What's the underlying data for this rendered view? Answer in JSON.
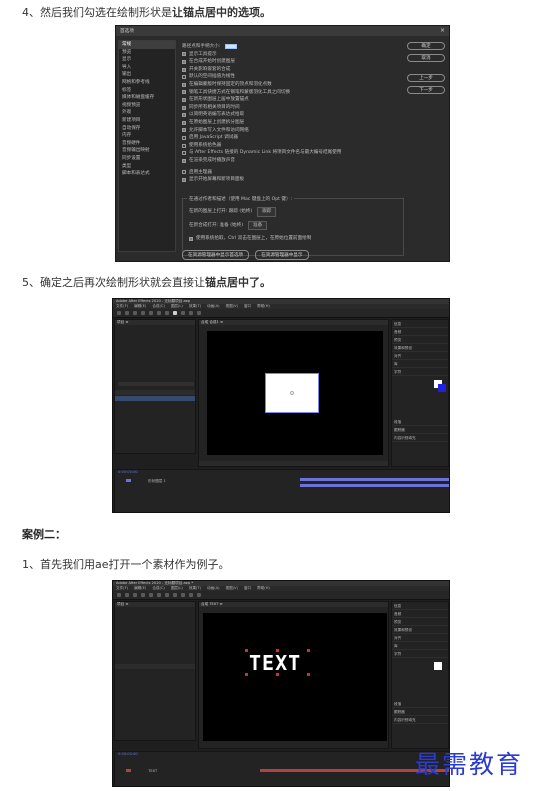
{
  "steps": {
    "s4_prefix": "4、然后我们勾选在绘制形状是",
    "s4_bold": "让锚点居中的选项。",
    "s5_prefix": "5、确定之后再次绘制形状就会直接让",
    "s5_bold": "锚点居中了。",
    "case2": "案例二：",
    "c1": "1、首先我们用ae打开一个素材作为例子。"
  },
  "prefs": {
    "title": "首选项",
    "close": "×",
    "side": [
      "常规",
      "预览",
      "显示",
      "导入",
      "输出",
      "网格和参考线",
      "标签",
      "媒体和磁盘缓存",
      "视频预览",
      "外观",
      "新建项目",
      "自动保存",
      "内存",
      "音频硬件",
      "音频输出映射",
      "同步设置",
      "类型",
      "脚本和表达式"
    ],
    "opts": [
      "路径点和手柄大小:",
      "显示工具提示",
      "在合成开始时创建图层",
      "开关影响嵌套的合成",
      "默认的空间插值为线性",
      "在编辑蒙版时保持固定的顶点和羽化点数",
      "钢笔工具快捷方式在钢笔和蒙版羽化工具之间切换",
      "在新形状图层上居中放置锚点",
      "同步所有相关项目的时间",
      "以简明英语编写表达式拾取",
      "在原始图层上创建拆分图层",
      "允许脚本写入文件和访问网络",
      "启用 JavaScript 调试器",
      "使用系统拾色器",
      "与 After Effects 链接的 Dynamic Link 将项目文件名与最大编号结尾使用",
      "在渲染完成时播放声音"
    ],
    "opts2": [
      "启用主理器",
      "显示开始屏幕和新项目面板"
    ],
    "group_legend": "在通过作者和描述（使用 Mac 键盘上的 Opt 键）:",
    "group_rows": [
      "在新的图层上打开: 跟踪 (始终)",
      "在新合成打开: 准备 (始终)",
      "使用系统拾取，Ctrl 双击在图层上，在原始位置前面绘制"
    ],
    "select_1": "跟踪",
    "select_2": "准备",
    "buttons": [
      "确定",
      "取消",
      "上一步",
      "下一步"
    ],
    "bottom_buttons": [
      "在资源管理器中显示首选项",
      "在资源管理器中显示"
    ],
    "number_value": "1"
  },
  "ae1": {
    "title": "Adobe After Effects 2020 - 无标题项目.aep",
    "menus": [
      "文件(F)",
      "编辑(E)",
      "合成(C)",
      "图层(L)",
      "效果(T)",
      "动画(A)",
      "视图(V)",
      "窗口",
      "帮助(H)"
    ],
    "proj_tab": "项目 ≡",
    "comp_tab": "合成 合成1 ≡",
    "right_items": [
      "信息",
      "音频",
      "预览",
      "效果和预设",
      "对齐",
      "库",
      "字符",
      "段落",
      "跟踪器",
      "内容识别填充"
    ],
    "time": "0:00:00:00",
    "layer_name": "形状图层 1"
  },
  "ae2": {
    "title": "Adobe After Effects 2020 - 无标题项目.aep *",
    "menus": [
      "文件(F)",
      "编辑(E)",
      "合成(C)",
      "图层(L)",
      "效果(T)",
      "动画(A)",
      "视图(V)",
      "窗口",
      "帮助(H)"
    ],
    "proj_tab": "项目 ≡",
    "comp_tab": "合成 TEXT ≡",
    "canvas_text": "TEXT",
    "right_items": [
      "信息",
      "音频",
      "预览",
      "效果和预设",
      "对齐",
      "库",
      "字符",
      "段落",
      "跟踪器",
      "内容识别填充"
    ],
    "time": "0:00:00:00",
    "layer_name": "TEXT"
  },
  "watermark": "最需教育",
  "colors": {
    "accent_blue": "#6b74d6",
    "anchor_red": "#d03030",
    "watermark": "#2a3bd0"
  }
}
